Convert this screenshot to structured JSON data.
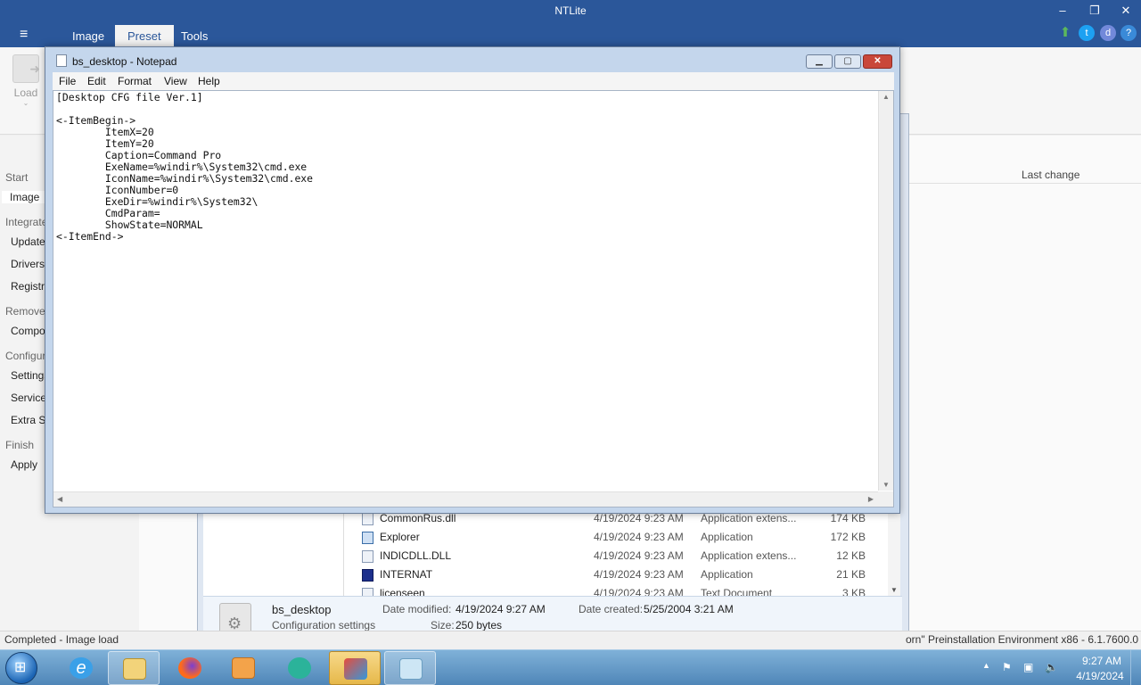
{
  "app": {
    "title": "NTLite",
    "window_controls": {
      "minimize": "–",
      "restore": "❐",
      "close": "✕"
    },
    "ribbon_tabs": [
      "Image",
      "Preset",
      "Tools"
    ],
    "active_tab": "Preset",
    "load_label": "Load",
    "top_icons": [
      "update-arrow-icon",
      "twitter-icon",
      "discord-icon",
      "help-icon"
    ]
  },
  "left_nav": {
    "sections": [
      {
        "label": "Start",
        "items": [
          "Image"
        ]
      },
      {
        "label": "Integrate",
        "items": [
          "Updates",
          "Drivers",
          "Registry"
        ]
      },
      {
        "label": "Remove",
        "items": [
          "Components"
        ]
      },
      {
        "label": "Configure",
        "items": [
          "Settings",
          "Services",
          "Extra Settings"
        ]
      },
      {
        "label": "Finish",
        "items": [
          "Apply"
        ]
      }
    ],
    "selected": "Image"
  },
  "list_header": {
    "last_change": "Last change"
  },
  "notepad": {
    "title": "bs_desktop - Notepad",
    "menu": [
      "File",
      "Edit",
      "Format",
      "View",
      "Help"
    ],
    "content": "[Desktop CFG file Ver.1]\n\n<-ItemBegin->\n        ItemX=20\n        ItemY=20\n        Caption=Command Pro\n        ExeName=%windir%\\System32\\cmd.exe\n        IconName=%windir%\\System32\\cmd.exe\n        IconNumber=0\n        ExeDir=%windir%\\System32\\\n        CmdParam=\n        ShowState=NORMAL\n<-ItemEnd->"
  },
  "explorer": {
    "files": [
      {
        "name": "CommonRus.dll",
        "date": "4/19/2024 9:23 AM",
        "type": "Application extens...",
        "size": "174 KB"
      },
      {
        "name": "Explorer",
        "date": "4/19/2024 9:23 AM",
        "type": "Application",
        "size": "172 KB"
      },
      {
        "name": "INDICDLL.DLL",
        "date": "4/19/2024 9:23 AM",
        "type": "Application extens...",
        "size": "12 KB"
      },
      {
        "name": "INTERNAT",
        "date": "4/19/2024 9:23 AM",
        "type": "Application",
        "size": "21 KB"
      },
      {
        "name": "licenseen",
        "date": "4/19/2024 9:23 AM",
        "type": "Text Document",
        "size": "3 KB"
      }
    ],
    "details": {
      "name": "bs_desktop",
      "type": "Configuration settings",
      "date_modified_label": "Date modified:",
      "date_modified": "4/19/2024 9:27 AM",
      "date_created_label": "Date created:",
      "date_created": "5/25/2004 3:21 AM",
      "size_label": "Size:",
      "size": "250 bytes"
    }
  },
  "status": {
    "left": "Completed - Image load",
    "right": "orn\" Preinstallation Environment x86 - 6.1.7600.0"
  },
  "taskbar": {
    "apps": [
      "internet-explorer-icon",
      "file-explorer-icon",
      "firefox-icon",
      "media-player-icon",
      "browser-app-icon",
      "ntlite-icon",
      "notepad-icon"
    ],
    "active_app": "ntlite-icon",
    "clock_time": "9:27 AM",
    "clock_date": "4/19/2024"
  },
  "colors": {
    "accent": "#2b579a",
    "taskbar": "#4f86b8",
    "close_red": "#c9473a"
  }
}
